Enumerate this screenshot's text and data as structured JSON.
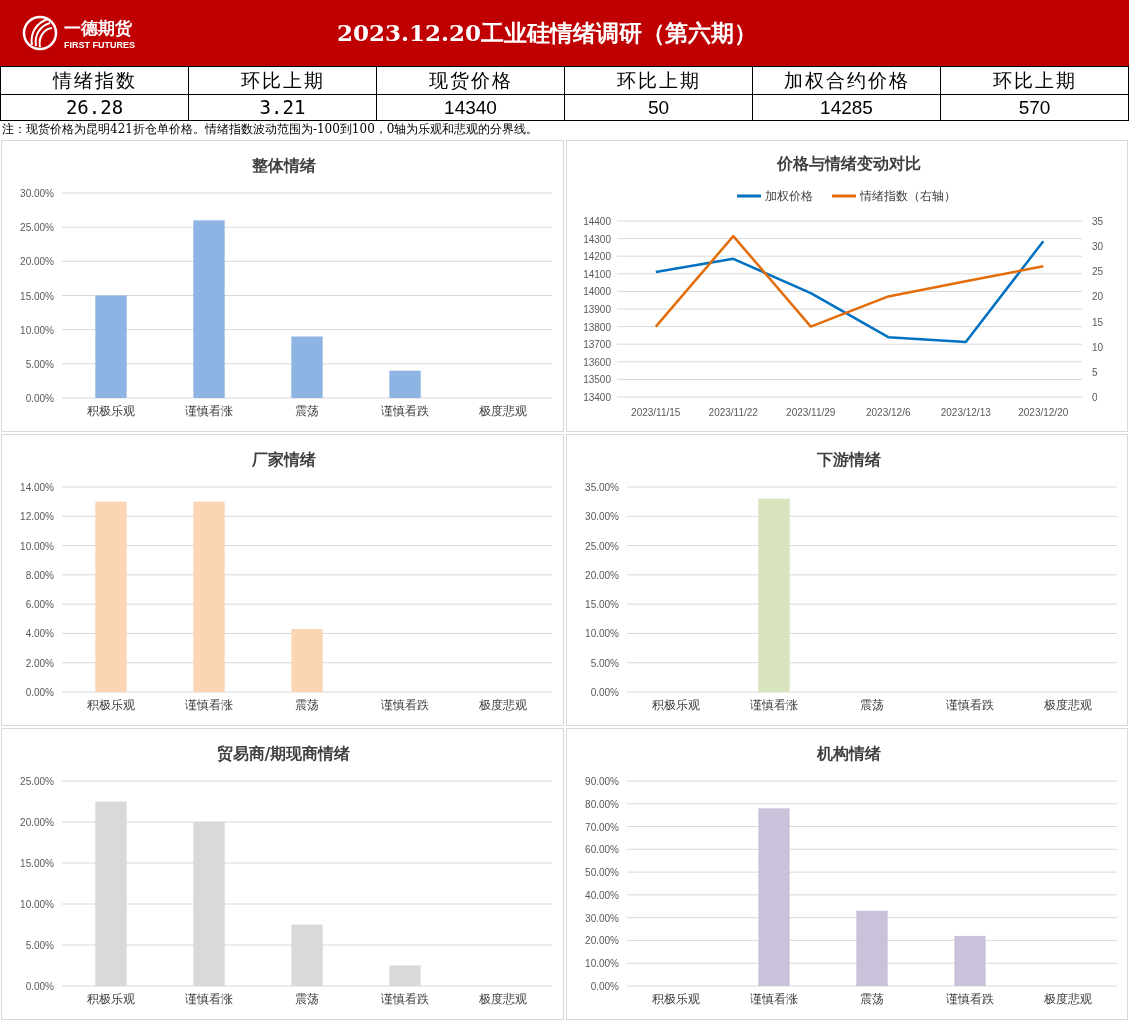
{
  "header": {
    "logo_name": "一德期货",
    "logo_subtitle": "FIRST FUTURES",
    "title": "2023.12.20工业硅情绪调研（第六期）"
  },
  "summary": [
    {
      "label": "情绪指数",
      "value": "26.28"
    },
    {
      "label": "环比上期",
      "value": "3.21"
    },
    {
      "label": "现货价格",
      "value": "14340"
    },
    {
      "label": "环比上期",
      "value": "50"
    },
    {
      "label": "加权合约价格",
      "value": "14285"
    },
    {
      "label": "环比上期",
      "value": "570"
    }
  ],
  "note": "注：现货价格为昆明421折仓单价格。情绪指数波动范围为-100到100，0轴为乐观和悲观的分界线。",
  "charts": [
    {
      "chart_data": {
        "type": "bar",
        "title": "整体情绪",
        "categories": [
          "积极乐观",
          "谨慎看涨",
          "震荡",
          "谨慎看跌",
          "极度悲观"
        ],
        "series": [
          {
            "color": "#8eb4e3",
            "values": [
              0.15,
              0.26,
              0.09,
              0.04,
              0
            ]
          }
        ],
        "grid": true,
        "ylim": [
          0,
          0.3
        ],
        "yticks": [
          {
            "value": 0,
            "label": "0.00%"
          },
          {
            "value": 0.05,
            "label": "5.00%"
          },
          {
            "value": 0.1,
            "label": "10.00%"
          },
          {
            "value": 0.15,
            "label": "15.00%"
          },
          {
            "value": 0.2,
            "label": "20.00%"
          },
          {
            "value": 0.25,
            "label": "25.00%"
          },
          {
            "value": 0.3,
            "label": "30.00%"
          }
        ]
      }
    },
    {
      "chart_data": {
        "type": "line",
        "title": "价格与情绪变动对比",
        "categories": [
          "2023/11/15",
          "2023/11/22",
          "2023/11/29",
          "2023/12/6",
          "2023/12/13",
          "2023/12/20"
        ],
        "series": [
          {
            "name": "加权价格",
            "color": "#0070c0",
            "values": [
              14110,
              14185,
              13990,
              13740,
              13712,
              14285
            ]
          },
          {
            "name": "情绪指数（右轴）",
            "color": "#e36c09",
            "axis": "y2",
            "values": [
              14,
              32,
              14,
              20,
              23,
              26
            ]
          }
        ],
        "legend": "top",
        "grid": true,
        "ylim": [
          13400,
          14400
        ],
        "yticks": [
          13400,
          13500,
          13600,
          13700,
          13800,
          13900,
          14000,
          14100,
          14200,
          14300,
          14400
        ],
        "y2lim": [
          0,
          35
        ],
        "y2ticks": [
          0,
          5,
          10,
          15,
          20,
          25,
          30,
          35
        ]
      }
    },
    {
      "chart_data": {
        "type": "bar",
        "title": "厂家情绪",
        "categories": [
          "积极乐观",
          "谨慎看涨",
          "震荡",
          "谨慎看跌",
          "极度悲观"
        ],
        "series": [
          {
            "color": "#fcd5b5",
            "values": [
              0.13,
              0.13,
              0.043,
              0,
              0
            ]
          }
        ],
        "grid": true,
        "ylim": [
          0,
          0.14
        ],
        "yticks": [
          {
            "value": 0,
            "label": "0.00%"
          },
          {
            "value": 0.02,
            "label": "2.00%"
          },
          {
            "value": 0.04,
            "label": "4.00%"
          },
          {
            "value": 0.06,
            "label": "6.00%"
          },
          {
            "value": 0.08,
            "label": "8.00%"
          },
          {
            "value": 0.1,
            "label": "10.00%"
          },
          {
            "value": 0.12,
            "label": "12.00%"
          },
          {
            "value": 0.14,
            "label": "14.00%"
          }
        ]
      }
    },
    {
      "chart_data": {
        "type": "bar",
        "title": "下游情绪",
        "categories": [
          "积极乐观",
          "谨慎看涨",
          "震荡",
          "谨慎看跌",
          "极度悲观"
        ],
        "series": [
          {
            "color": "#d7e4bd",
            "values": [
              0,
              0.33,
              0,
              0,
              0
            ]
          }
        ],
        "grid": true,
        "ylim": [
          0,
          0.35
        ],
        "yticks": [
          {
            "value": 0,
            "label": "0.00%"
          },
          {
            "value": 0.05,
            "label": "5.00%"
          },
          {
            "value": 0.1,
            "label": "10.00%"
          },
          {
            "value": 0.15,
            "label": "15.00%"
          },
          {
            "value": 0.2,
            "label": "20.00%"
          },
          {
            "value": 0.25,
            "label": "25.00%"
          },
          {
            "value": 0.3,
            "label": "30.00%"
          },
          {
            "value": 0.35,
            "label": "35.00%"
          }
        ]
      }
    },
    {
      "chart_data": {
        "type": "bar",
        "title": "贸易商/期现商情绪",
        "categories": [
          "积极乐观",
          "谨慎看涨",
          "震荡",
          "谨慎看跌",
          "极度悲观"
        ],
        "series": [
          {
            "color": "#d9d9d9",
            "values": [
              0.225,
              0.2,
              0.075,
              0.025,
              0
            ]
          }
        ],
        "grid": true,
        "ylim": [
          0,
          0.25
        ],
        "yticks": [
          {
            "value": 0,
            "label": "0.00%"
          },
          {
            "value": 0.05,
            "label": "5.00%"
          },
          {
            "value": 0.1,
            "label": "10.00%"
          },
          {
            "value": 0.15,
            "label": "15.00%"
          },
          {
            "value": 0.2,
            "label": "20.00%"
          },
          {
            "value": 0.25,
            "label": "25.00%"
          }
        ]
      }
    },
    {
      "chart_data": {
        "type": "bar",
        "title": "机构情绪",
        "categories": [
          "积极乐观",
          "谨慎看涨",
          "震荡",
          "谨慎看跌",
          "极度悲观"
        ],
        "series": [
          {
            "color": "#ccc1da",
            "values": [
              0,
              0.78,
              0.33,
              0.22,
              0
            ]
          }
        ],
        "grid": true,
        "ylim": [
          0,
          0.9
        ],
        "yticks": [
          {
            "value": 0,
            "label": "0.00%"
          },
          {
            "value": 0.1,
            "label": "10.00%"
          },
          {
            "value": 0.2,
            "label": "20.00%"
          },
          {
            "value": 0.3,
            "label": "30.00%"
          },
          {
            "value": 0.4,
            "label": "40.00%"
          },
          {
            "value": 0.5,
            "label": "50.00%"
          },
          {
            "value": 0.6,
            "label": "60.00%"
          },
          {
            "value": 0.7,
            "label": "70.00%"
          },
          {
            "value": 0.8,
            "label": "80.00%"
          },
          {
            "value": 0.9,
            "label": "90.00%"
          }
        ]
      }
    }
  ]
}
